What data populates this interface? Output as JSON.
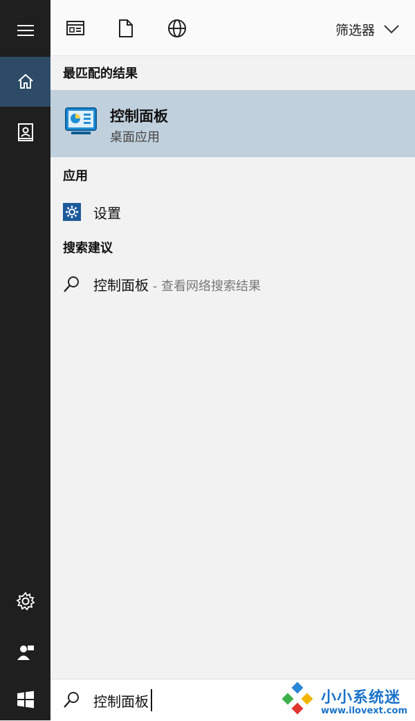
{
  "rail": {
    "items": [
      {
        "name": "hamburger-menu-icon"
      },
      {
        "name": "home-icon"
      },
      {
        "name": "notebook-icon"
      },
      {
        "name": "gear-icon"
      },
      {
        "name": "feedback-icon"
      }
    ]
  },
  "topbar": {
    "icons": [
      "apps-filter-icon",
      "documents-filter-icon",
      "web-filter-icon"
    ],
    "filter_label": "筛选器"
  },
  "sections": {
    "best_match": "最匹配的结果",
    "apps": "应用",
    "suggestions": "搜索建议"
  },
  "best_match": {
    "title": "控制面板",
    "subtitle": "桌面应用"
  },
  "apps": [
    {
      "label": "设置"
    }
  ],
  "suggestions": [
    {
      "label": "控制面板",
      "suffix": " - 查看网络搜索结果"
    }
  ],
  "search": {
    "value": "控制面板"
  },
  "watermark": {
    "title": "小小系统迷",
    "url": "www.ilovext.com"
  },
  "colors": {
    "rail_bg": "#1f1f1f",
    "active_rail": "#2d4b66",
    "best_match_bg": "#c0d0dc",
    "accent": "#1a73c9"
  }
}
